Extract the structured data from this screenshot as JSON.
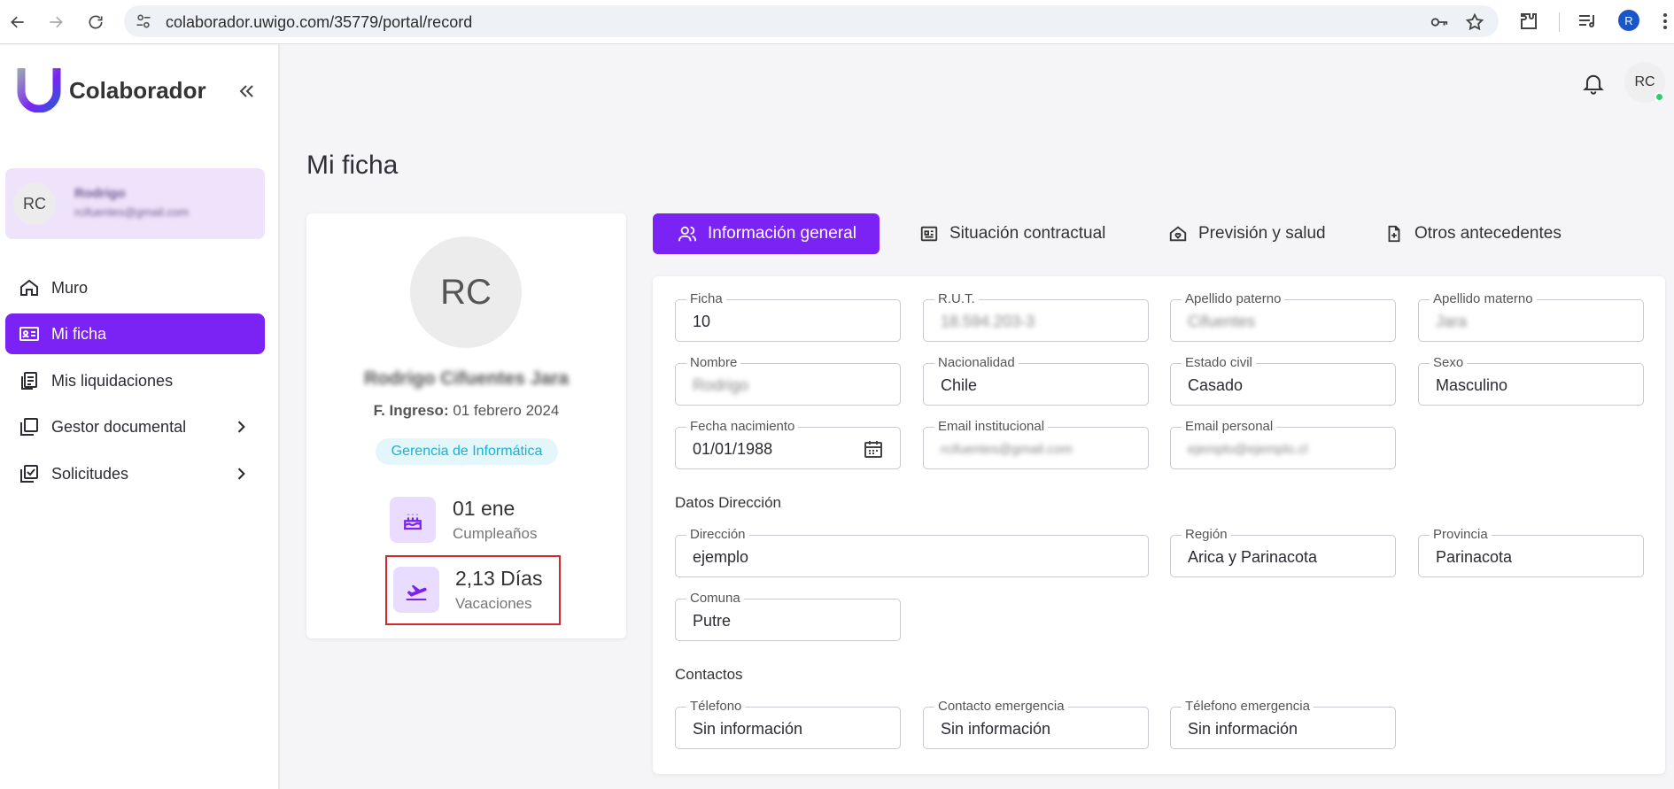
{
  "browser": {
    "url": "colaborador.uwigo.com/35779/portal/record",
    "profile_initial": "R"
  },
  "sidebar": {
    "app_name": "Colaborador",
    "user": {
      "initials": "RC",
      "name": "Rodrigo",
      "email": "rcifuentes@gmail.com"
    },
    "items": [
      {
        "label": "Muro",
        "icon": "home-icon",
        "active": false
      },
      {
        "label": "Mi ficha",
        "icon": "id-card-icon",
        "active": true
      },
      {
        "label": "Mis liquidaciones",
        "icon": "payslips-icon",
        "active": false
      },
      {
        "label": "Gestor documental",
        "icon": "folder-icon",
        "active": false,
        "submenu": true
      },
      {
        "label": "Solicitudes",
        "icon": "requests-icon",
        "active": false,
        "submenu": true
      }
    ]
  },
  "header": {
    "avatar_initials": "RC"
  },
  "page": {
    "title": "Mi ficha"
  },
  "profile": {
    "initials": "RC",
    "full_name": "Rodrigo Cifuentes Jara",
    "ingreso_label": "F. Ingreso:",
    "ingreso_value": "01 febrero 2024",
    "department": "Gerencia de Informática",
    "birthday_value": "01 ene",
    "birthday_label": "Cumpleaños",
    "vacation_value": "2,13 Días",
    "vacation_label": "Vacaciones"
  },
  "tabs": [
    {
      "label": "Información general",
      "active": true
    },
    {
      "label": "Situación contractual",
      "active": false
    },
    {
      "label": "Previsión y salud",
      "active": false
    },
    {
      "label": "Otros antecedentes",
      "active": false
    }
  ],
  "fields": {
    "ficha": {
      "label": "Ficha",
      "value": "10"
    },
    "rut": {
      "label": "R.U.T.",
      "value": "18.594.203-3"
    },
    "apellido_paterno": {
      "label": "Apellido paterno",
      "value": "Cifuentes"
    },
    "apellido_materno": {
      "label": "Apellido materno",
      "value": "Jara"
    },
    "nombre": {
      "label": "Nombre",
      "value": "Rodrigo"
    },
    "nacionalidad": {
      "label": "Nacionalidad",
      "value": "Chile"
    },
    "estado_civil": {
      "label": "Estado civil",
      "value": "Casado"
    },
    "sexo": {
      "label": "Sexo",
      "value": "Masculino"
    },
    "fecha_nacimiento": {
      "label": "Fecha nacimiento",
      "value": "01/01/1988"
    },
    "email_institucional": {
      "label": "Email institucional",
      "value": "rcifuentes@gmail.com"
    },
    "email_personal": {
      "label": "Email personal",
      "value": "ejemplo@ejemplo.cl"
    },
    "direccion": {
      "label": "Dirección",
      "value": "ejemplo"
    },
    "region": {
      "label": "Región",
      "value": "Arica y Parinacota"
    },
    "provincia": {
      "label": "Provincia",
      "value": "Parinacota"
    },
    "comuna": {
      "label": "Comuna",
      "value": "Putre"
    },
    "telefono": {
      "label": "Télefono",
      "value": "Sin información"
    },
    "contacto_emergencia": {
      "label": "Contacto emergencia",
      "value": "Sin información"
    },
    "telefono_emergencia": {
      "label": "Télefono emergencia",
      "value": "Sin información"
    }
  },
  "sections": {
    "direccion": "Datos Dirección",
    "contactos": "Contactos"
  },
  "colors": {
    "accent": "#7b22f4",
    "chip_text": "#16b3d6",
    "chip_bg": "#e3f7fb",
    "highlight": "#d3262d"
  }
}
